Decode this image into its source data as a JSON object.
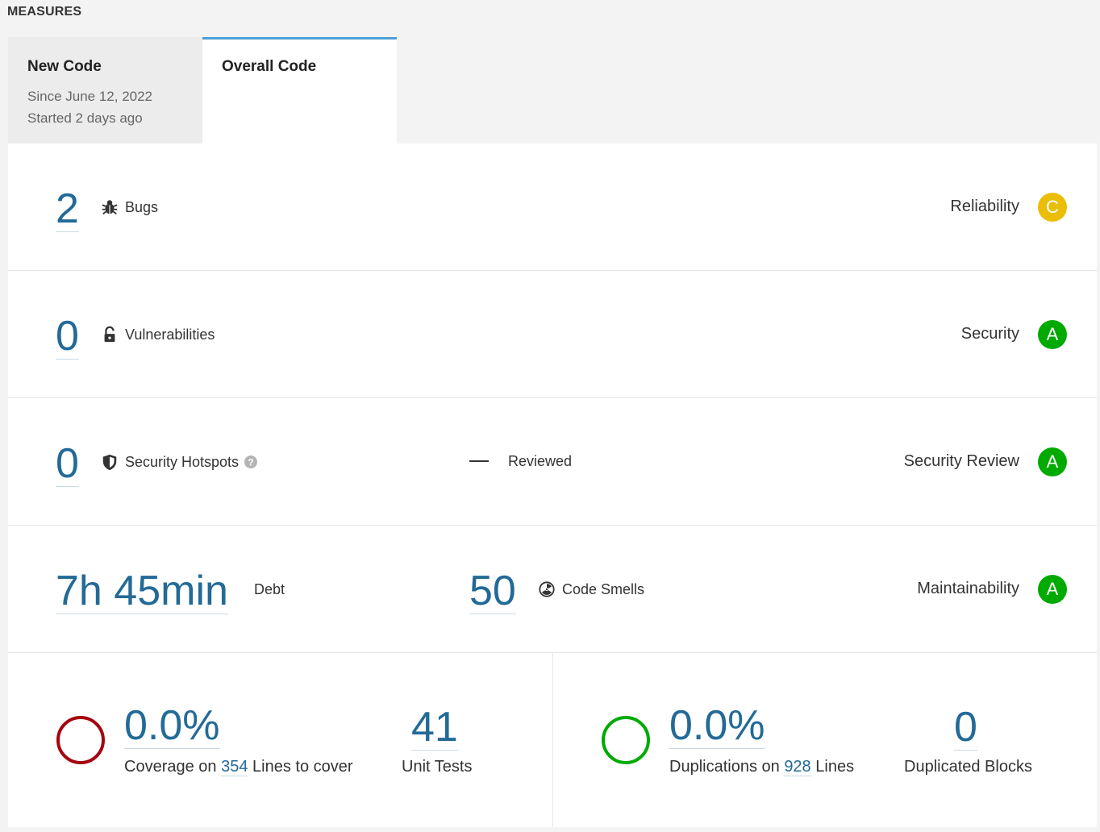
{
  "header": {
    "title": "MEASURES"
  },
  "tabs": {
    "new_code": {
      "label": "New Code",
      "since": "Since June 12, 2022",
      "started": "Started 2 days ago"
    },
    "overall": {
      "label": "Overall Code"
    }
  },
  "reliability": {
    "value": "2",
    "label": "Bugs",
    "icon": "bug-icon",
    "rating_label": "Reliability",
    "rating": "C",
    "rating_color": "#eabe06"
  },
  "security": {
    "value": "0",
    "label": "Vulnerabilities",
    "icon": "lock-icon",
    "rating_label": "Security",
    "rating": "A",
    "rating_color": "#00aa00"
  },
  "hotspots": {
    "value": "0",
    "label": "Security Hotspots",
    "icon": "shield-icon",
    "help_icon": "help-icon",
    "reviewed_value": "—",
    "reviewed_label": "Reviewed",
    "rating_label": "Security Review",
    "rating": "A",
    "rating_color": "#00aa00"
  },
  "maintainability": {
    "debt_value": "7h 45min",
    "debt_label": "Debt",
    "smells_value": "50",
    "smells_label": "Code Smells",
    "icon": "radiation-icon",
    "rating_label": "Maintainability",
    "rating": "A",
    "rating_color": "#00aa00"
  },
  "coverage": {
    "value": "0.0%",
    "text_prefix": "Coverage on",
    "lines": "354",
    "text_suffix": "Lines to cover",
    "ring_color": "#a4030f",
    "tests_value": "41",
    "tests_label": "Unit Tests"
  },
  "duplications": {
    "value": "0.0%",
    "text_prefix": "Duplications on",
    "lines": "928",
    "text_suffix": "Lines",
    "ring_color": "#00aa00",
    "blocks_value": "0",
    "blocks_label": "Duplicated Blocks"
  }
}
